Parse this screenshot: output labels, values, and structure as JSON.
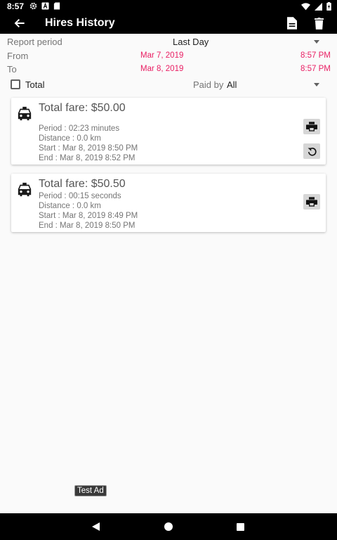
{
  "status_bar": {
    "time": "8:57"
  },
  "toolbar": {
    "title": "Hires History"
  },
  "filters": {
    "report_period_label": "Report period",
    "report_period_value": "Last Day",
    "from_label": "From",
    "from_date": "Mar 7, 2019",
    "from_time": "8:57 PM",
    "to_label": "To",
    "to_date": "Mar 8, 2019",
    "to_time": "8:57 PM",
    "total_label": "Total",
    "total_checked": false,
    "paid_by_label": "Paid by",
    "paid_by_value": "All"
  },
  "hires": [
    {
      "fare": "Total fare: $50.00",
      "period": "Period : 02:23 minutes",
      "distance": "Distance : 0.0 km",
      "start": "Start : Mar 8, 2019 8:50 PM",
      "end": "End : Mar 8, 2019 8:52 PM"
    },
    {
      "fare": "Total fare: $50.50",
      "period": "Period : 00:15 seconds",
      "distance": "Distance : 0.0 km",
      "start": "Start : Mar 8, 2019 8:49 PM",
      "end": "End : Mar 8, 2019 8:50 PM"
    }
  ],
  "ad": {
    "label": "Test Ad"
  },
  "colors": {
    "accent": "#e91e63",
    "toolbar": "#000000",
    "background": "#fafafa"
  }
}
